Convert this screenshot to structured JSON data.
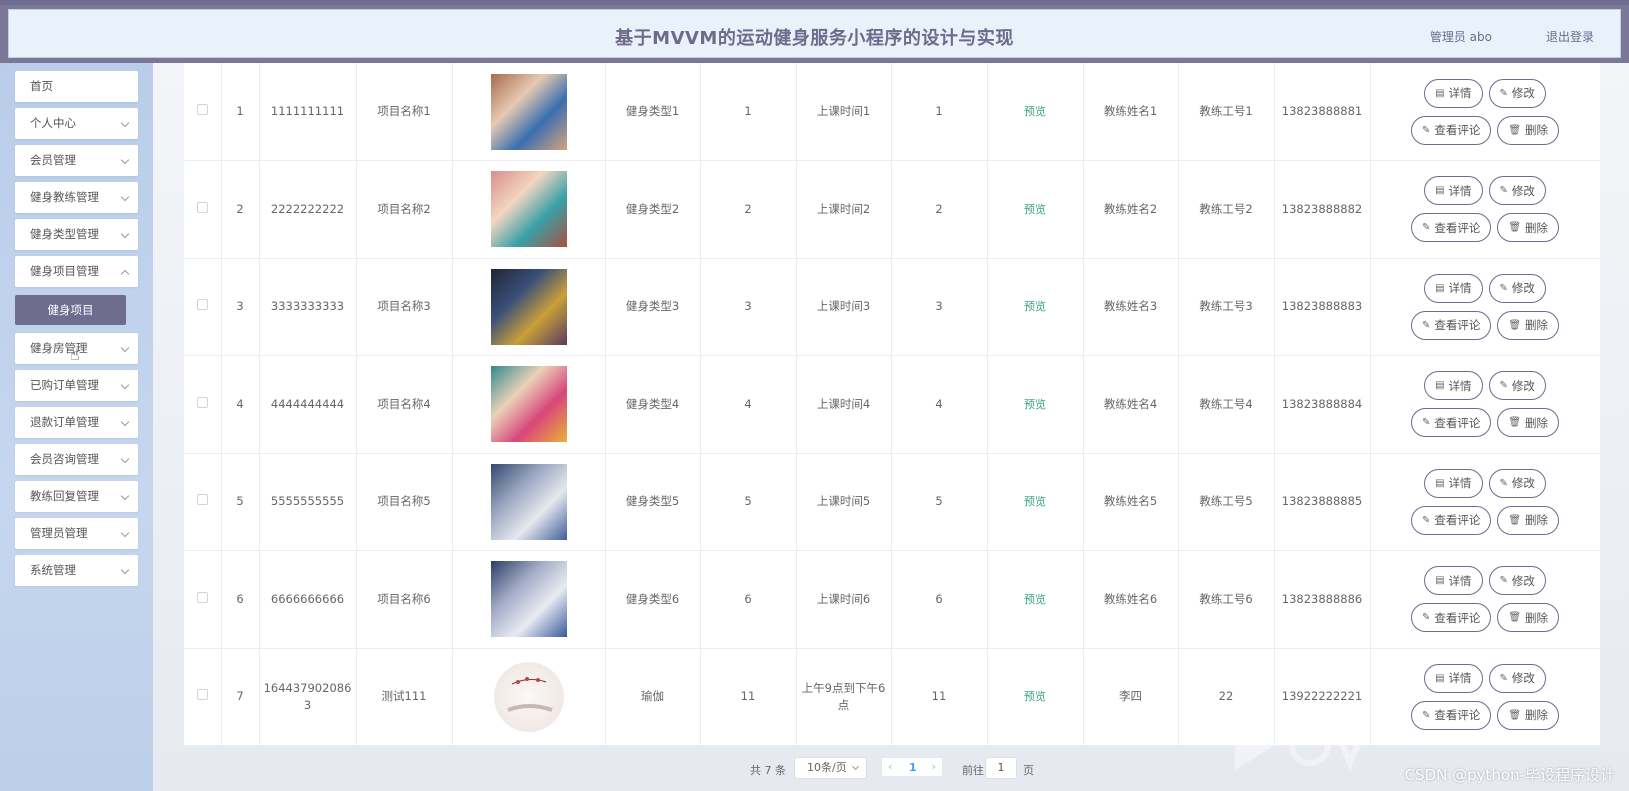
{
  "header": {
    "title": "基于MVVM的运动健身服务小程序的设计与实现",
    "user": "管理员 abo",
    "logout": "退出登录"
  },
  "sidebar": {
    "items": [
      {
        "label": "首页"
      },
      {
        "label": "个人中心"
      },
      {
        "label": "会员管理"
      },
      {
        "label": "健身教练管理"
      },
      {
        "label": "健身类型管理"
      },
      {
        "label": "健身项目管理"
      },
      {
        "label": "健身房管理"
      },
      {
        "label": "已购订单管理"
      },
      {
        "label": "退款订单管理"
      },
      {
        "label": "会员咨询管理"
      },
      {
        "label": "教练回复管理"
      },
      {
        "label": "管理员管理"
      },
      {
        "label": "系统管理"
      }
    ],
    "sub_item": "健身项目"
  },
  "table": {
    "status_text": "预览",
    "buttons": {
      "detail": "详情",
      "edit": "修改",
      "comments": "查看评论",
      "delete": "删除"
    },
    "rows": [
      {
        "index": "1",
        "code": "1111111111",
        "name": "项目名称1",
        "type": "健身类型1",
        "n1": "1",
        "time": "上课时间1",
        "n2": "1",
        "coach": "教练姓名1",
        "coach_id": "教练工号1",
        "phone": "13823888881"
      },
      {
        "index": "2",
        "code": "2222222222",
        "name": "项目名称2",
        "type": "健身类型2",
        "n1": "2",
        "time": "上课时间2",
        "n2": "2",
        "coach": "教练姓名2",
        "coach_id": "教练工号2",
        "phone": "13823888882"
      },
      {
        "index": "3",
        "code": "3333333333",
        "name": "项目名称3",
        "type": "健身类型3",
        "n1": "3",
        "time": "上课时间3",
        "n2": "3",
        "coach": "教练姓名3",
        "coach_id": "教练工号3",
        "phone": "13823888883"
      },
      {
        "index": "4",
        "code": "4444444444",
        "name": "项目名称4",
        "type": "健身类型4",
        "n1": "4",
        "time": "上课时间4",
        "n2": "4",
        "coach": "教练姓名4",
        "coach_id": "教练工号4",
        "phone": "13823888884"
      },
      {
        "index": "5",
        "code": "5555555555",
        "name": "项目名称5",
        "type": "健身类型5",
        "n1": "5",
        "time": "上课时间5",
        "n2": "5",
        "coach": "教练姓名5",
        "coach_id": "教练工号5",
        "phone": "13823888885"
      },
      {
        "index": "6",
        "code": "6666666666",
        "name": "项目名称6",
        "type": "健身类型6",
        "n1": "6",
        "time": "上课时间6",
        "n2": "6",
        "coach": "教练姓名6",
        "coach_id": "教练工号6",
        "phone": "13823888886"
      },
      {
        "index": "7",
        "code": "1644379020863",
        "name": "测试111",
        "type": "瑜伽",
        "n1": "11",
        "time": "上午9点到下午6点",
        "n2": "11",
        "coach": "李四",
        "coach_id": "22",
        "phone": "13922222221"
      }
    ]
  },
  "pagination": {
    "total": "共 7 条",
    "page_size": "10条/页",
    "prev": "‹",
    "current": "1",
    "next": "›",
    "goto_label": "前往",
    "goto_value": "1",
    "page_label": "页"
  },
  "watermark": "CSDN @python-毕设程序设计",
  "colors": {
    "accent": "#6e6c8f",
    "status": "#3aa57a",
    "sidebar_bg": "#bfd1ec",
    "header_bg": "#e9f2fb"
  }
}
